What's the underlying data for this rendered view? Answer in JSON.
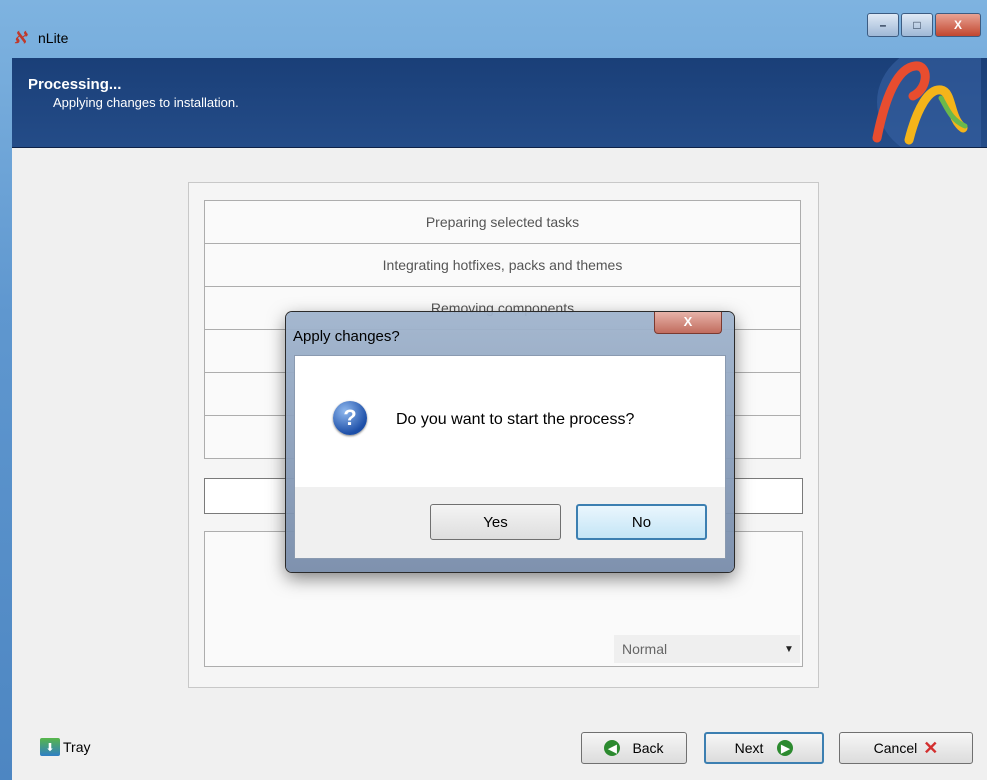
{
  "window": {
    "title": "nLite",
    "controls": {
      "minimize": "–",
      "maximize": "□",
      "close": "X"
    }
  },
  "header": {
    "title": "Processing...",
    "subtitle": "Applying changes to installation."
  },
  "tasks": [
    "Preparing selected tasks",
    "Integrating hotfixes, packs and themes",
    "Removing components",
    "",
    "",
    ""
  ],
  "priority_select": {
    "value": "Normal"
  },
  "footer": {
    "tray_label": "Tray",
    "back_label": "Back",
    "next_label": "Next",
    "cancel_label": "Cancel"
  },
  "dialog": {
    "title": "Apply changes?",
    "close": "X",
    "message": "Do you want to start the process?",
    "icon_glyph": "?",
    "yes_label": "Yes",
    "no_label": "No"
  },
  "colors": {
    "header_bg": "#1a3f78",
    "accent": "#3c7fb1",
    "next_circle": "#2c8a2f",
    "cancel_x": "#d32f2f"
  }
}
